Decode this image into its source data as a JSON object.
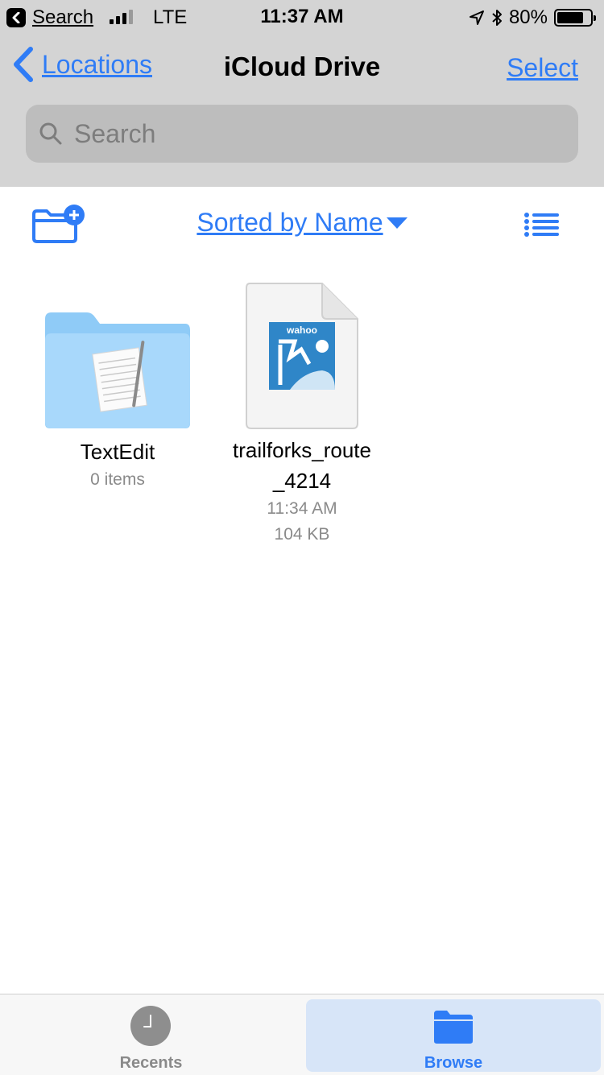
{
  "status_bar": {
    "back_app": "Search",
    "carrier": "LTE",
    "time": "11:37 AM",
    "battery_percent": "80%",
    "battery_level": 0.8,
    "signal_bars_filled": 3,
    "signal_bars_total": 4
  },
  "nav": {
    "back_label": "Locations",
    "title": "iCloud Drive",
    "select_label": "Select"
  },
  "search": {
    "placeholder": "Search"
  },
  "toolbar": {
    "sort_label": "Sorted by Name"
  },
  "items": [
    {
      "name": "TextEdit",
      "meta": "0 items",
      "icon": "folder-icon"
    },
    {
      "name_line1": "trailforks_route",
      "name_line2": "_4214",
      "time": "11:34 AM",
      "size": "104 KB",
      "icon": "wahoo-file-icon",
      "logo_text": "wahoo"
    }
  ],
  "tabs": [
    {
      "label": "Recents",
      "icon": "clock-icon"
    },
    {
      "label": "Browse",
      "icon": "folder-icon",
      "selected": true
    }
  ],
  "colors": {
    "accent": "#2f7cf6",
    "header_bg": "#d4d4d4",
    "folder_light": "#a8d8fb",
    "selected_tab_bg": "#d7e5f8"
  }
}
